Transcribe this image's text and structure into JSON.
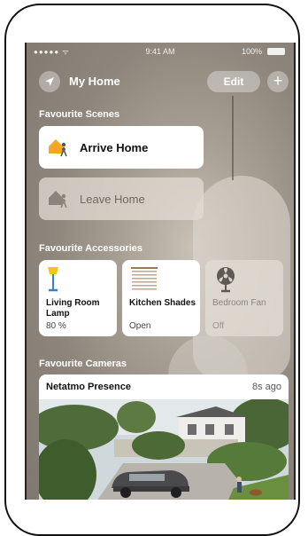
{
  "status_bar": {
    "signal": "●●●●● ᯤ",
    "time": "9:41 AM",
    "battery": "100%"
  },
  "header": {
    "title": "My Home",
    "edit_label": "Edit",
    "add_label": "+"
  },
  "sections": {
    "scenes": "Favourite Scenes",
    "accessories": "Favourite Accessories",
    "cameras": "Favourite Cameras"
  },
  "scenes": [
    {
      "label": "Arrive Home",
      "active": true
    },
    {
      "label": "Leave Home",
      "active": false
    }
  ],
  "accessories": [
    {
      "name": "Living Room Lamp",
      "state": "80 %",
      "active": true,
      "icon": "lamp-icon"
    },
    {
      "name": "Kitchen Shades",
      "state": "Open",
      "active": true,
      "icon": "shades-icon"
    },
    {
      "name": "Bedroom Fan",
      "state": "Off",
      "active": false,
      "icon": "fan-icon"
    }
  ],
  "camera": {
    "name": "Netatmo Presence",
    "time": "8s ago"
  },
  "colors": {
    "accent": "#f5a623",
    "tile_on": "#ffffff",
    "tile_off": "#e1dcd4"
  }
}
